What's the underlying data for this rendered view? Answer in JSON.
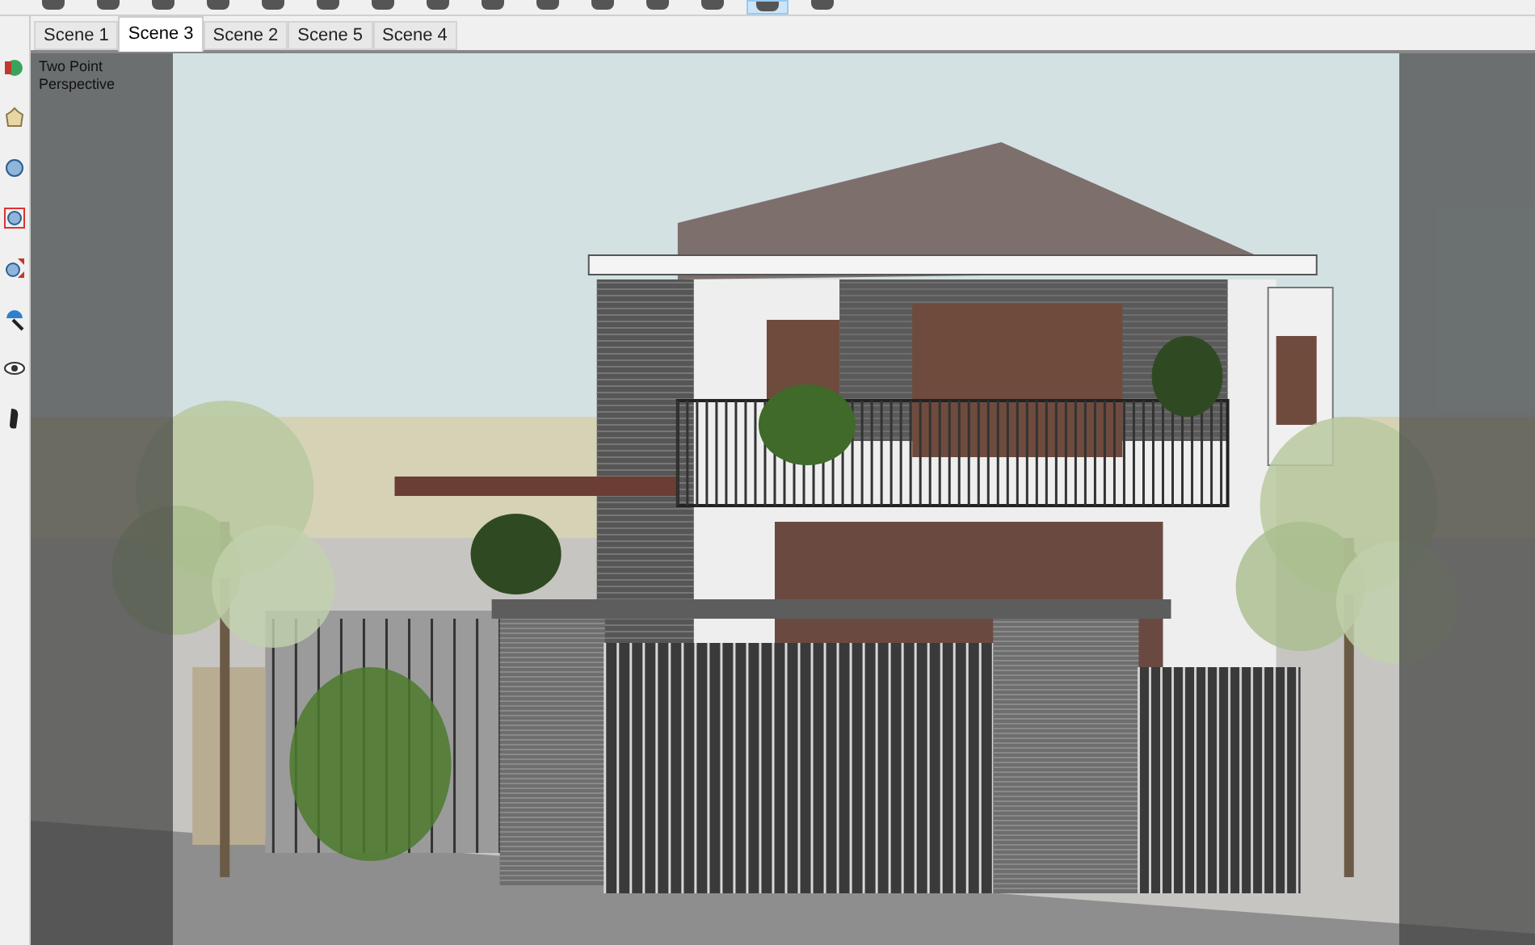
{
  "toolbar_buttons": [
    {
      "selected": false
    },
    {
      "selected": false
    },
    {
      "selected": false
    },
    {
      "selected": false
    },
    {
      "selected": false
    },
    {
      "selected": false
    },
    {
      "selected": false
    },
    {
      "selected": false
    },
    {
      "selected": false
    },
    {
      "selected": false
    },
    {
      "selected": false
    },
    {
      "selected": false
    },
    {
      "selected": false
    },
    {
      "selected": true
    },
    {
      "selected": false
    }
  ],
  "scene_tabs": [
    {
      "label": "Scene 1",
      "selected": false
    },
    {
      "label": "Scene 3",
      "selected": true
    },
    {
      "label": "Scene 2",
      "selected": false
    },
    {
      "label": "Scene 5",
      "selected": false
    },
    {
      "label": "Scene 4",
      "selected": false
    }
  ],
  "viewport": {
    "camera_label": "Two Point Perspective"
  }
}
